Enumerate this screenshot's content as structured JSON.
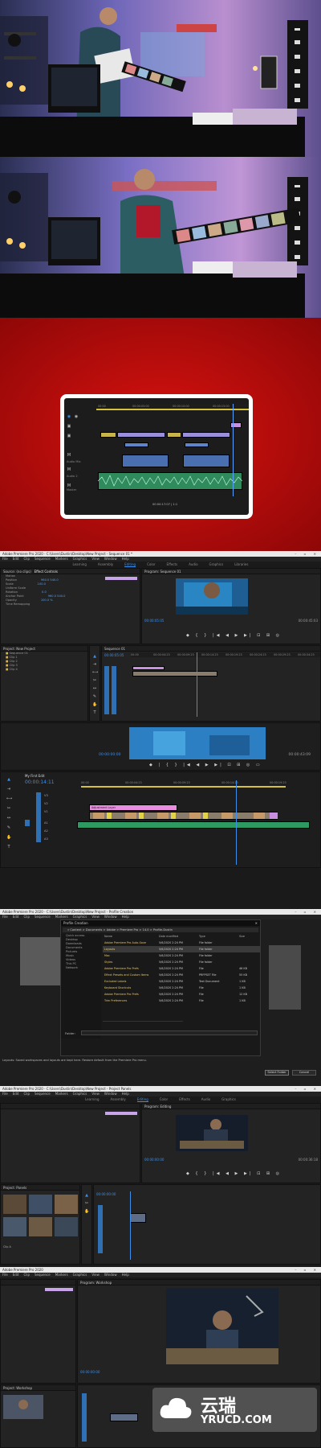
{
  "frame1": {
    "scene": "studio-man-holding-film-strip"
  },
  "frame2": {
    "scene": "studio-man-stretching-film-strip"
  },
  "frame3": {
    "background": "#d10f0f",
    "timecodes": [
      "00:00",
      "00:00:05:00",
      "00:00:10:00",
      "00:00:15:00"
    ],
    "bottom_label": "00:00:17:07  |  1:1",
    "track_labels": [
      "Audio Mix",
      "Audio 2",
      "Master"
    ]
  },
  "s1": {
    "title": "Adobe Premiere Pro 2020 - C:\\Users\\Dustin\\Desktop\\New Project - Sequence 01 *",
    "menu": [
      "File",
      "Edit",
      "Clip",
      "Sequence",
      "Markers",
      "Graphics",
      "View",
      "Window",
      "Help"
    ],
    "workspace_tabs": [
      "Learning",
      "Assembly",
      "Editing",
      "Color",
      "Effects",
      "Audio",
      "Graphics",
      "Libraries"
    ],
    "effect_controls_tab": "Effect Controls",
    "source_label": "Source: (no clips)",
    "program_label": "Program: Sequence 01",
    "sequence_label": "Sequence 01",
    "effect_rows": [
      "Motion",
      "Position",
      "Scale",
      "Uniform Scale",
      "Rotation",
      "Anchor Point",
      "Opacity",
      "Time Remapping"
    ],
    "effect_values": [
      "960.0  540.0",
      "100.0",
      "",
      "0.0",
      "960.0  540.0",
      "100.0 %",
      ""
    ],
    "program_tc": "00:00:05:05",
    "program_end": "00:00:45:03",
    "project_tab": "Project: New Project",
    "bins": [
      "Sequence 01",
      "Clip 1",
      "Clip 2",
      "Clip 3",
      "Clip 4"
    ],
    "timeline_tc": "00:00:05:05",
    "ruler": [
      "00:00",
      "00:00:04:23",
      "00:00:09:23",
      "00:00:14:23",
      "00:00:19:23",
      "00:00:24:23",
      "00:00:29:23",
      "00:00:34:23"
    ],
    "big_tc": "00:00:00:00",
    "big_end": "00:00:43:09",
    "seq_title": "My First Edit",
    "seq_tc": "00:00:14:11",
    "seq_ruler": [
      "00:00",
      "00:00:04:23",
      "00:00:09:23",
      "00:00:14:23",
      "00:00:19:23"
    ],
    "tracks": [
      "V3",
      "V2",
      "V1",
      "A1",
      "A2",
      "A3"
    ],
    "clip_pink_label": "Adjustment Layer"
  },
  "s2": {
    "title": "Adobe Premiere Pro 2020 - C:\\Users\\Dustin\\Desktop\\New Project - Profile Creation",
    "menu": [
      "File",
      "Edit",
      "Clip",
      "Sequence",
      "Markers",
      "Graphics",
      "View",
      "Window",
      "Help"
    ],
    "dialog_title": "Profile Creation",
    "address": "« Content > Documents > Adobe > Premiere Pro > 14.0 > Profile-Dustin",
    "columns": [
      "Name",
      "Date modified",
      "Type",
      "Size"
    ],
    "files": [
      [
        "Adobe Premiere Pro Auto-Save",
        "5/6/2020 2:24 PM",
        "File folder",
        ""
      ],
      [
        "Layouts",
        "5/6/2020 2:24 PM",
        "File folder",
        ""
      ],
      [
        "Mac",
        "5/6/2020 2:24 PM",
        "File folder",
        ""
      ],
      [
        "Styles",
        "5/6/2020 2:24 PM",
        "File folder",
        ""
      ],
      [
        "Adobe Premiere Pro Prefs",
        "5/6/2020 2:24 PM",
        "File",
        "46 KB"
      ],
      [
        "Effect Presets and Custom Items",
        "5/6/2020 2:24 PM",
        "PRFPSET File",
        "55 KB"
      ],
      [
        "Excluded Labels",
        "5/6/2020 2:24 PM",
        "Text Document",
        "1 KB"
      ],
      [
        "Keyboard Shortcuts",
        "5/6/2020 2:24 PM",
        "File",
        "1 KB"
      ],
      [
        "Adobe Premiere Pro Prefs",
        "5/6/2020 2:24 PM",
        "File",
        "12 KB"
      ],
      [
        "Trim Preferences",
        "5/6/2020 2:24 PM",
        "File",
        "1 KB"
      ]
    ],
    "folder_tree": [
      "Quick access",
      "Desktop",
      "Downloads",
      "Documents",
      "Pictures",
      "Music",
      "Videos",
      "This PC",
      "Network"
    ],
    "filename_label": "Folder:",
    "status": "Layouts: Saved workspaces and layouts are kept here. Restore default from the Premiere Pro menu.",
    "btn_select": "Select Folder",
    "btn_cancel": "Cancel"
  },
  "s3": {
    "title": "Adobe Premiere Pro 2020 - C:\\Users\\Dustin\\Desktop\\New Project - Project Panels",
    "menu": [
      "File",
      "Edit",
      "Clip",
      "Sequence",
      "Markers",
      "Graphics",
      "View",
      "Window",
      "Help"
    ],
    "workspace_tabs": [
      "Learning",
      "Assembly",
      "Editing",
      "Color",
      "Effects",
      "Audio",
      "Graphics"
    ],
    "program_label": "Program: Editing",
    "program_tc": "00:00:00:00",
    "program_end": "00:00:36:18",
    "project_tab": "Project: Panels",
    "timeline_tc": "00:00:00:00",
    "thumbs": [
      "Clip A",
      "Clip B",
      "Clip C",
      "Clip D",
      "Clip E",
      "Clip F"
    ]
  },
  "s4": {
    "title": "Adobe Premiere Pro 2020",
    "menu": [
      "File",
      "Edit",
      "Clip",
      "Sequence",
      "Markers",
      "Graphics",
      "View",
      "Window",
      "Help"
    ],
    "program_label": "Program: Workshop",
    "program_tc": "00:00:00:00",
    "project_tab": "Project: Workshop",
    "watermark_main": "云瑞",
    "watermark_sub": "YRUCD.COM"
  }
}
